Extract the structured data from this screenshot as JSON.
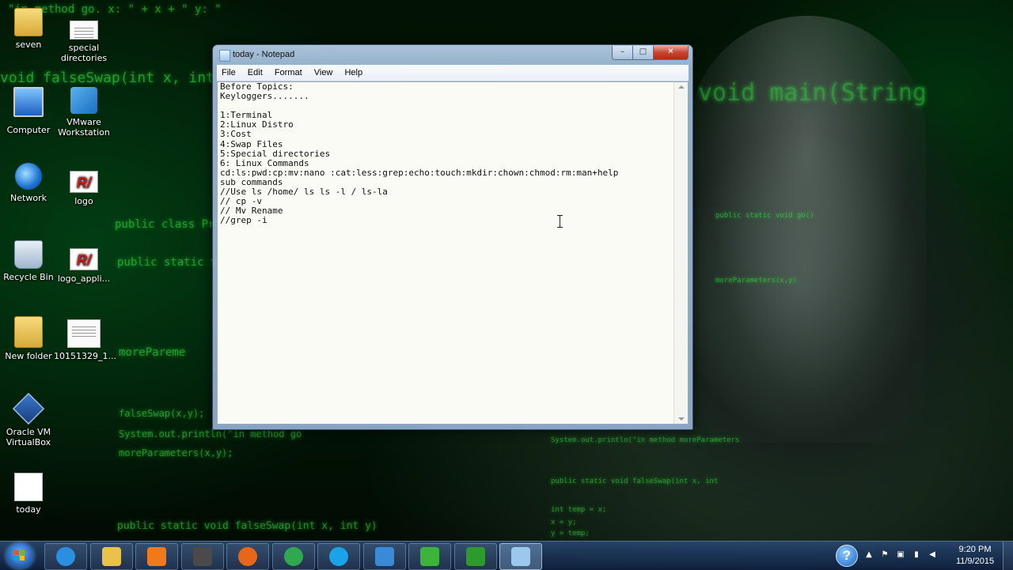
{
  "desktop": {
    "icons": [
      {
        "label": "seven",
        "icon": "user-folder-icon"
      },
      {
        "label": "special directories",
        "icon": "text-file-icon"
      },
      {
        "label": "Computer",
        "icon": "computer-icon"
      },
      {
        "label": "VMware Workstation",
        "icon": "vmware-icon"
      },
      {
        "label": "Network",
        "icon": "network-icon"
      },
      {
        "label": "logo",
        "icon": "image-file-icon"
      },
      {
        "label": "Recycle Bin",
        "icon": "recycle-bin-icon"
      },
      {
        "label": "logo_appli...",
        "icon": "image-file-icon"
      },
      {
        "label": "New folder",
        "icon": "folder-icon"
      },
      {
        "label": "10151329_1...",
        "icon": "image-file-icon"
      },
      {
        "label": "Oracle VM VirtualBox",
        "icon": "virtualbox-icon"
      },
      {
        "label": "today",
        "icon": "text-file-icon"
      }
    ],
    "wallpaper_code": [
      "\"in method go. x: \" + x + \" y: \"",
      "void falseSwap(int x, int y)",
      "public class Prim",
      "public static void",
      "morePareme",
      "System.out.println(\"in method go",
      "falseSwap(x,y);",
      "moreParameters(x,y);",
      "public static void falseSwap(int x, int y)",
      "void main(String",
      "public static void go()",
      "moreParameters(x,y)",
      "System.out.println(\"in method moreParameters",
      "public static void falseSwap(int x, int",
      "int temp = x;",
      "x = y;",
      "y = temp;"
    ]
  },
  "notepad": {
    "title": "today - Notepad",
    "buttons": {
      "minimize": "–",
      "maximize": "□",
      "close": "✕"
    },
    "menu": [
      "File",
      "Edit",
      "Format",
      "View",
      "Help"
    ],
    "content": "Before Topics:\nKeyloggers.......\n\n1:Terminal\n2:Linux Distro\n3:Cost\n4:Swap Files\n5:Special directories\n6: Linux Commands\ncd:ls:pwd:cp:mv:nano :cat:less:grep:echo:touch:mkdir:chown:chmod:rm:man+help\nsub commands\n//Use ls /home/ ls ls -l / ls-la\n// cp -v\n// Mv Rename\n//grep -i"
  },
  "taskbar": {
    "pinned": [
      {
        "name": "internet-explorer",
        "color": "#2a8fe0"
      },
      {
        "name": "file-explorer",
        "color": "#e8c24a"
      },
      {
        "name": "media-player",
        "color": "#f07a1a"
      },
      {
        "name": "sublime-text",
        "color": "#4a4a4a"
      },
      {
        "name": "firefox",
        "color": "#e8661a"
      },
      {
        "name": "chrome",
        "color": "#2fa84f"
      },
      {
        "name": "skype",
        "color": "#1aa3e8"
      },
      {
        "name": "vmware",
        "color": "#3a8ad8"
      },
      {
        "name": "camtasia-recorder",
        "color": "#3cb43c"
      },
      {
        "name": "camtasia-studio",
        "color": "#2e9a2e"
      },
      {
        "name": "notepad",
        "color": "#9cc8ee"
      }
    ],
    "help_label": "?",
    "clock": {
      "time": "9:20 PM",
      "date": "11/9/2015"
    }
  }
}
